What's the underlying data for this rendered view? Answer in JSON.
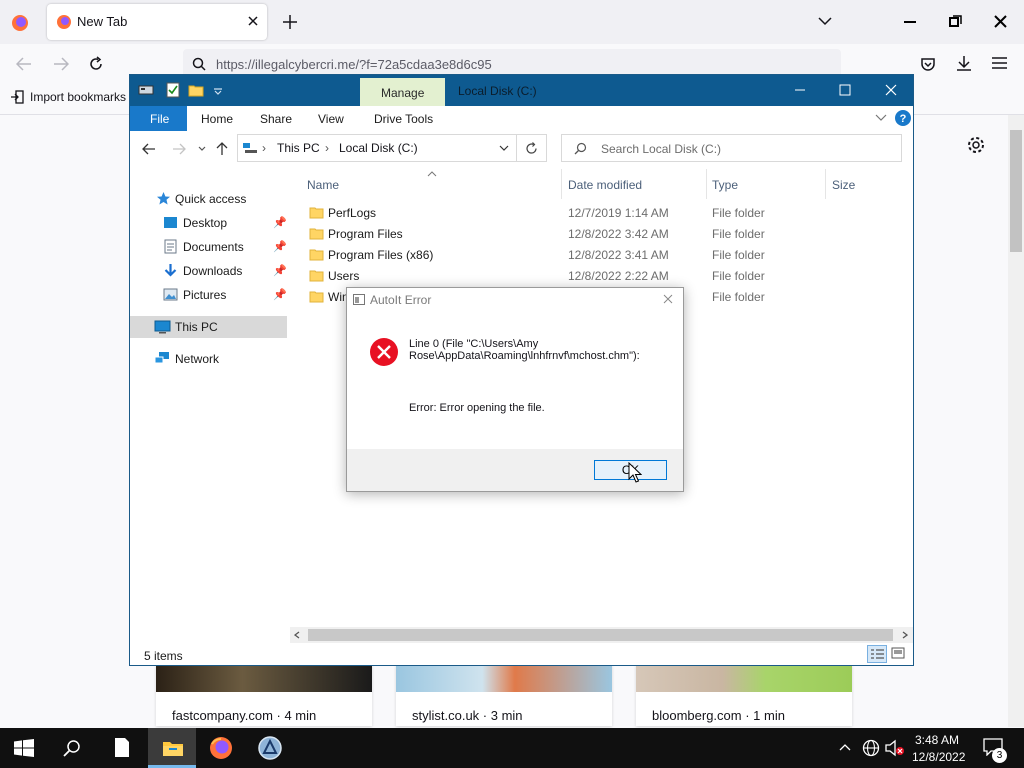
{
  "browser": {
    "tab_title": "New Tab",
    "url": "https://illegalcybercri.me/?f=72a5cdaa3e8d6c95",
    "bookmark_import": "Import bookmarks"
  },
  "cards": [
    {
      "label": "fastcompany.com · 4 min"
    },
    {
      "label": "stylist.co.uk · 3 min"
    },
    {
      "label": "bloomberg.com · 1 min"
    }
  ],
  "explorer": {
    "manage_tab": "Manage",
    "title": "Local Disk (C:)",
    "ribbon": [
      "File",
      "Home",
      "Share",
      "View",
      "Drive Tools"
    ],
    "breadcrumb": [
      "This PC",
      "Local Disk (C:)"
    ],
    "search_placeholder": "Search Local Disk (C:)",
    "nav": {
      "quick_access": "Quick access",
      "desktop": "Desktop",
      "documents": "Documents",
      "downloads": "Downloads",
      "pictures": "Pictures",
      "this_pc": "This PC",
      "network": "Network"
    },
    "columns": {
      "name": "Name",
      "date": "Date modified",
      "type": "Type",
      "size": "Size"
    },
    "rows": [
      {
        "name": "PerfLogs",
        "date": "12/7/2019 1:14 AM",
        "type": "File folder"
      },
      {
        "name": "Program Files",
        "date": "12/8/2022 3:42 AM",
        "type": "File folder"
      },
      {
        "name": "Program Files (x86)",
        "date": "12/8/2022 3:41 AM",
        "type": "File folder"
      },
      {
        "name": "Users",
        "date": "12/8/2022 2:22 AM",
        "type": "File folder"
      },
      {
        "name": "Win",
        "date": "",
        "type": "File folder"
      }
    ],
    "status": "5 items"
  },
  "dialog": {
    "title": "AutoIt Error",
    "line1": "Line 0  (File \"C:\\Users\\Amy",
    "line2": "Rose\\AppData\\Roaming\\lnhfrnvf\\mchost.chm\"):",
    "error": "Error: Error opening the file.",
    "ok": "OK"
  },
  "taskbar": {
    "time": "3:48 AM",
    "date": "12/8/2022",
    "notifications": "3"
  },
  "colors": {
    "explorer_title": "#0e5a90",
    "file_tab": "#1979ca",
    "manage_tab": "#e3f0d0",
    "error_red": "#e81123"
  }
}
